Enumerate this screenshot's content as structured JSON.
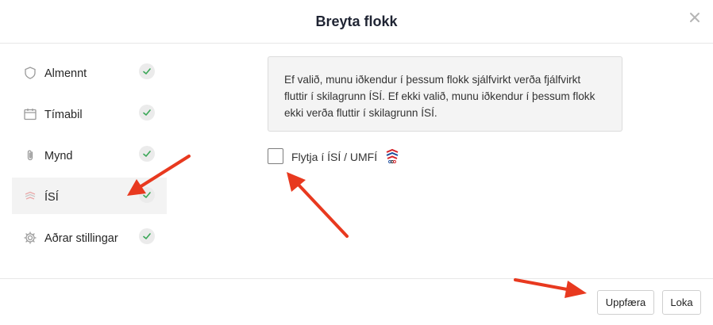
{
  "modal": {
    "title": "Breyta flokk"
  },
  "sidebar": {
    "items": [
      {
        "label": "Almennt",
        "icon": "shield-icon"
      },
      {
        "label": "Tímabil",
        "icon": "calendar-icon"
      },
      {
        "label": "Mynd",
        "icon": "paperclip-icon"
      },
      {
        "label": "ÍSÍ",
        "icon": "isi-logo-icon"
      },
      {
        "label": "Aðrar stillingar",
        "icon": "gear-icon"
      }
    ]
  },
  "main": {
    "info_text": "Ef valið, munu iðkendur í þessum flokk sjálfvirkt verða fjálfvirkt fluttir í skilagrunn ÍSÍ. Ef ekki valið, munu iðkendur í þessum flokk ekki verða fluttir í skilagrunn ÍSÍ.",
    "checkbox_label": "Flytja í ÍSÍ / UMFÍ"
  },
  "footer": {
    "update_label": "Uppfæra",
    "close_label": "Loka"
  },
  "colors": {
    "accent_arrow": "#e8391f",
    "check_green": "#3aa757",
    "title": "#1f2433"
  }
}
